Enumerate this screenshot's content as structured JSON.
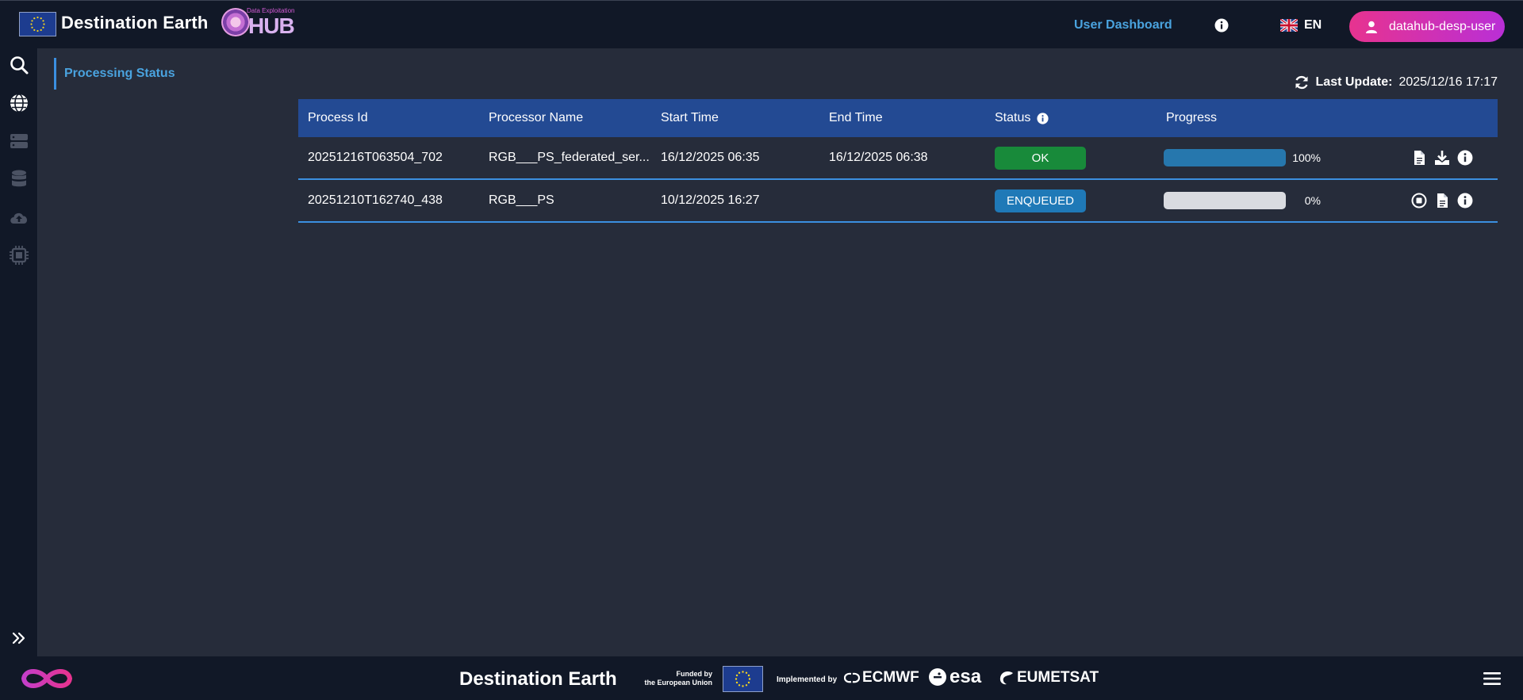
{
  "header": {
    "brand_title": "Destination Earth",
    "hub_subtitle": "Data Exploitation",
    "hub_text": "HUB",
    "nav_dashboard": "User Dashboard",
    "language": "EN",
    "user_name": "datahub-desp-user"
  },
  "sidebar": {
    "items": [
      {
        "icon": "search-icon"
      },
      {
        "icon": "globe-icon"
      },
      {
        "icon": "server-icon"
      },
      {
        "icon": "database-icon"
      },
      {
        "icon": "cloud-upload-icon"
      },
      {
        "icon": "chip-icon"
      }
    ],
    "expand_icon": "double-chevron-right-icon"
  },
  "page": {
    "breadcrumb": "Processing Status",
    "last_update_label": "Last Update:",
    "last_update_value": "2025/12/16 17:17"
  },
  "table": {
    "columns": [
      "Process Id",
      "Processor Name",
      "Start Time",
      "End Time",
      "Status",
      "Progress"
    ],
    "rows": [
      {
        "process_id": "20251216T063504_702",
        "processor_name": "RGB___PS_federated_ser...",
        "start_time": "16/12/2025 06:35",
        "end_time": "16/12/2025 06:38",
        "status": "OK",
        "progress": 100,
        "progress_label": "100%",
        "actions": [
          "document-icon",
          "download-icon",
          "info-icon"
        ]
      },
      {
        "process_id": "20251210T162740_438",
        "processor_name": "RGB___PS",
        "start_time": "10/12/2025 16:27",
        "end_time": "",
        "status": "ENQUEUED",
        "progress": 0,
        "progress_label": "0%",
        "actions": [
          "stop-icon",
          "document-icon",
          "info-icon"
        ]
      }
    ]
  },
  "footer": {
    "title": "Destination Earth",
    "funded_line1": "Funded by",
    "funded_line2": "the European Union",
    "implemented_by": "Implemented by",
    "partners": [
      "ECMWF",
      "esa",
      "EUMETSAT"
    ]
  },
  "colors": {
    "accent": "#4aa3df",
    "header_bg": "#111827",
    "page_bg": "#262c3a",
    "table_header": "#234a93",
    "status_ok": "#188a3a",
    "status_enqueued": "#1f79b7",
    "user_gradient_start": "#e7338f",
    "user_gradient_end": "#b92fd6"
  }
}
